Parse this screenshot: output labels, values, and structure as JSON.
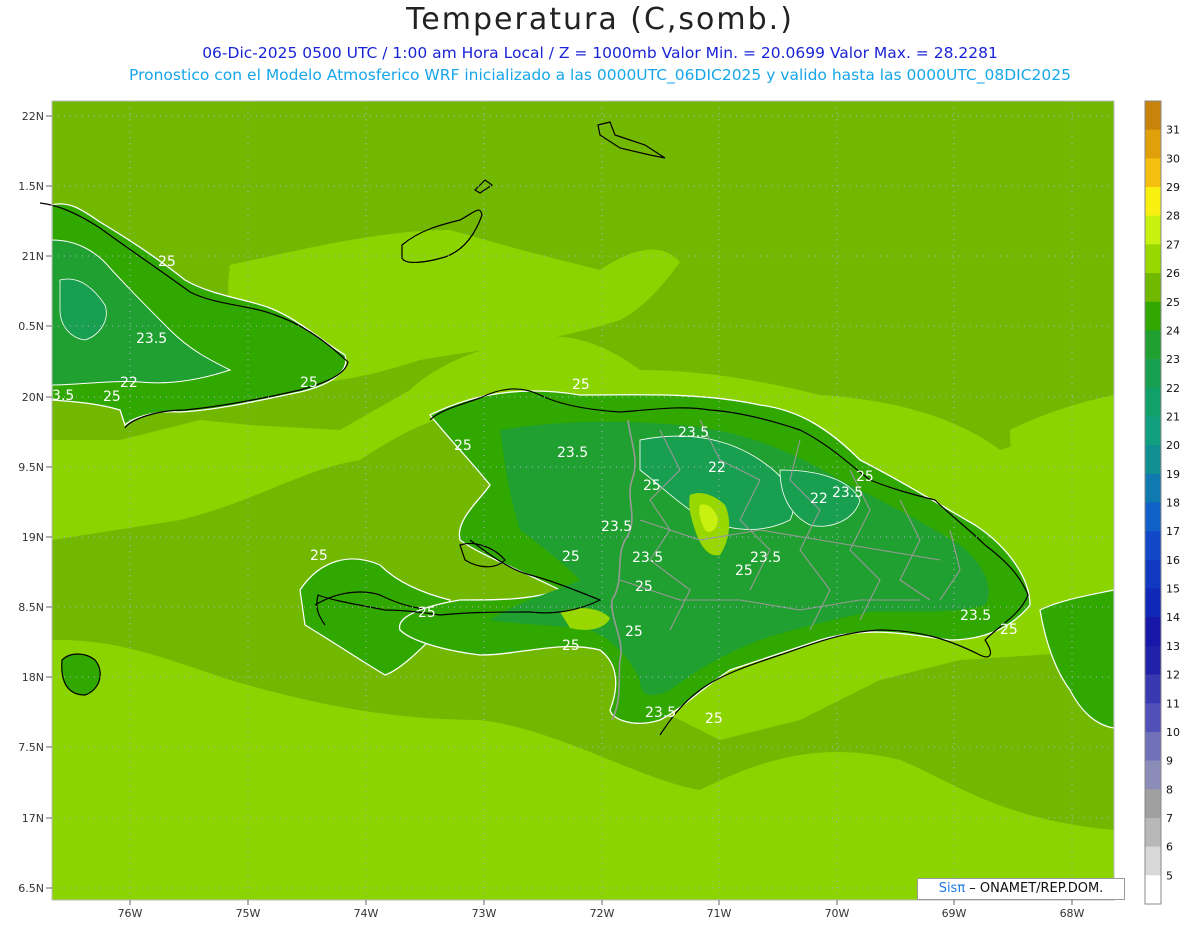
{
  "header": {
    "title": "Temperatura (C,somb.)",
    "line1": "06-Dic-2025  0500 UTC / 1:00 am Hora Local / Z = 1000mb   Valor Min. = 20.0699  Valor Max. = 28.2281",
    "line2": "Pronostico con el Modelo Atmosferico WRF inicializado a las 0000UTC_06DIC2025 y valido hasta las  0000UTC_08DIC2025"
  },
  "axes": {
    "lat_labels": [
      "22N",
      "1.5N",
      "21N",
      "0.5N",
      "20N",
      "9.5N",
      "19N",
      "8.5N",
      "18N",
      "7.5N",
      "17N",
      "6.5N"
    ],
    "lon_labels": [
      "76W",
      "75W",
      "74W",
      "73W",
      "72W",
      "71W",
      "70W",
      "69W",
      "68W"
    ]
  },
  "colorbar": {
    "labels": [
      "31",
      "30",
      "29",
      "28",
      "27",
      "26",
      "25",
      "24",
      "23",
      "22",
      "21",
      "20",
      "19",
      "18",
      "17",
      "16",
      "15",
      "14",
      "13",
      "12",
      "11",
      "10",
      "9",
      "8",
      "7",
      "6",
      "5"
    ],
    "colors": [
      "#c8830a",
      "#e0a00a",
      "#f5c010",
      "#f8f010",
      "#c8f010",
      "#98d800",
      "#70b800",
      "#30a800",
      "#20a030",
      "#18a050",
      "#10a068",
      "#10a080",
      "#109090",
      "#107ab0",
      "#1060c8",
      "#1048c8",
      "#1038c0",
      "#1028b8",
      "#1818a8",
      "#2020a8",
      "#3838b0",
      "#5050b8",
      "#7070b8",
      "#8c8cb8",
      "#a0a0a0",
      "#b8b8b8",
      "#d8d8d8",
      "#ffffff"
    ]
  },
  "contours": [
    {
      "text": "25",
      "pos": "cuba-25a"
    },
    {
      "text": "23.5",
      "pos": "cuba-235a"
    },
    {
      "text": "22",
      "pos": "cuba-22"
    },
    {
      "text": "25",
      "pos": "cuba-25b"
    },
    {
      "text": "3.5",
      "pos": "cuba-35"
    },
    {
      "text": "25",
      "pos": "cuba-25c"
    },
    {
      "text": "25",
      "pos": "hisp-25n"
    },
    {
      "text": "25",
      "pos": "hisp-25w"
    },
    {
      "text": "23.5",
      "pos": "hisp-235a"
    },
    {
      "text": "23.5",
      "pos": "hisp-235b"
    },
    {
      "text": "22",
      "pos": "hisp-22a"
    },
    {
      "text": "25",
      "pos": "hisp-25ne"
    },
    {
      "text": "22",
      "pos": "hisp-22b"
    },
    {
      "text": "23.5",
      "pos": "hisp-235c"
    },
    {
      "text": "25",
      "pos": "hisp-25c"
    },
    {
      "text": "23.5",
      "pos": "hisp-235d"
    },
    {
      "text": "25",
      "pos": "hisp-25d"
    },
    {
      "text": "23.5",
      "pos": "hisp-235e"
    },
    {
      "text": "25",
      "pos": "hisp-25e"
    },
    {
      "text": "23.5",
      "pos": "hisp-235f"
    },
    {
      "text": "25",
      "pos": "hisp-25f"
    },
    {
      "text": "25",
      "pos": "hisp-25g"
    },
    {
      "text": "25",
      "pos": "hisp-25h"
    },
    {
      "text": "25",
      "pos": "hisp-25i"
    },
    {
      "text": "25",
      "pos": "hisp-25j"
    },
    {
      "text": "25",
      "pos": "hisp-25k"
    },
    {
      "text": "23.5",
      "pos": "hisp-235g"
    },
    {
      "text": "25",
      "pos": "hisp-25l"
    }
  ],
  "credit": {
    "sis": "Sisπ",
    "rest": " – ONAMET/REP.DOM."
  }
}
